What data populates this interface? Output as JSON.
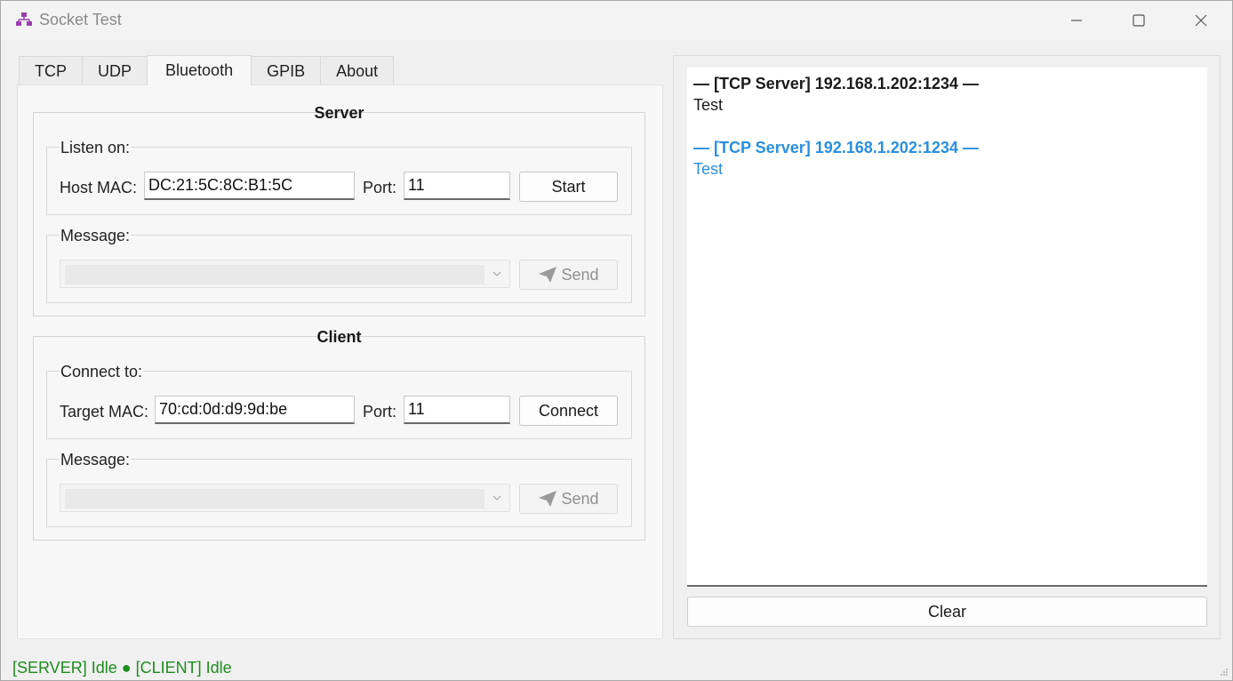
{
  "window": {
    "title": "Socket Test",
    "icon": "network-icon"
  },
  "tabs": [
    {
      "label": "TCP",
      "active": false
    },
    {
      "label": "UDP",
      "active": false
    },
    {
      "label": "Bluetooth",
      "active": true
    },
    {
      "label": "GPIB",
      "active": false
    },
    {
      "label": "About",
      "active": false
    }
  ],
  "server": {
    "title": "Server",
    "listen_label": "Listen on:",
    "host_mac_label": "Host MAC:",
    "host_mac_value": "DC:21:5C:8C:B1:5C",
    "port_label": "Port:",
    "port_value": "11",
    "start_label": "Start",
    "message_label": "Message:",
    "message_value": "",
    "send_label": "Send"
  },
  "client": {
    "title": "Client",
    "connect_label": "Connect to:",
    "target_mac_label": "Target MAC:",
    "target_mac_value": "70:cd:0d:d9:9d:be",
    "port_label": "Port:",
    "port_value": "11",
    "connect_button_label": "Connect",
    "message_label": "Message:",
    "message_value": "",
    "send_label": "Send"
  },
  "log": {
    "entries": [
      {
        "header": "— [TCP Server] 192.168.1.202:1234 —",
        "body": "Test",
        "kind": "sent"
      },
      {
        "header": "— [TCP Server] 192.168.1.202:1234 —",
        "body": "Test",
        "kind": "received"
      }
    ],
    "clear_label": "Clear"
  },
  "status_bar": {
    "text": "[SERVER] Idle ● [CLIENT] Idle"
  },
  "colors": {
    "received": "#2a8fe0",
    "status": "#1e8c1e"
  }
}
